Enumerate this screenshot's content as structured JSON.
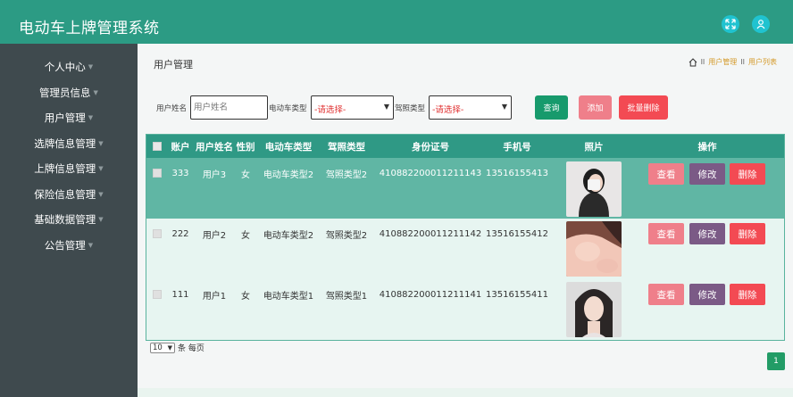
{
  "app": {
    "title": "电动车上牌管理系统"
  },
  "header_icons": [
    "fullscreen-icon",
    "user-icon"
  ],
  "sidebar": {
    "items": [
      {
        "label": "个人中心"
      },
      {
        "label": "管理员信息"
      },
      {
        "label": "用户管理"
      },
      {
        "label": "选牌信息管理"
      },
      {
        "label": "上牌信息管理"
      },
      {
        "label": "保险信息管理"
      },
      {
        "label": "基础数据管理"
      },
      {
        "label": "公告管理"
      }
    ]
  },
  "page": {
    "title": "用户管理",
    "breadcrumb": {
      "sep1": "II",
      "item1": "用户管理",
      "sep2": "II",
      "item2": "用户列表"
    }
  },
  "search": {
    "name_label": "用户姓名",
    "name_placeholder": "用户姓名",
    "ev_type_label": "电动车类型",
    "ev_type_value": "-请选择-",
    "license_label": "驾照类型",
    "license_value": "-请选择-",
    "query_btn": "查询",
    "add_btn": "添加",
    "batch_delete_btn": "批量删除"
  },
  "table": {
    "headers": [
      "账户",
      "用户姓名",
      "性别",
      "电动车类型",
      "驾照类型",
      "身份证号",
      "手机号",
      "照片",
      "操作"
    ],
    "rows": [
      {
        "account": "333",
        "name": "用户3",
        "gender": "女",
        "ev_type": "电动车类型2",
        "license": "驾照类型2",
        "id_no": "410882200011211143",
        "phone": "13516155413"
      },
      {
        "account": "222",
        "name": "用户2",
        "gender": "女",
        "ev_type": "电动车类型2",
        "license": "驾照类型2",
        "id_no": "410882200011211142",
        "phone": "13516155412"
      },
      {
        "account": "111",
        "name": "用户1",
        "gender": "女",
        "ev_type": "电动车类型1",
        "license": "驾照类型1",
        "id_no": "410882200011211141",
        "phone": "13516155411"
      }
    ],
    "actions": {
      "view": "查看",
      "edit": "修改",
      "delete": "删除"
    }
  },
  "pagination": {
    "page_size": "10",
    "per_page_label": "条 每页",
    "current_page": "1"
  },
  "colors": {
    "header": "#2c9b84",
    "sidebar": "#3f4a4e",
    "table_header": "#2f9985",
    "view_btn": "#ef7f8a",
    "edit_btn": "#7b5a86",
    "delete_btn": "#f34a53",
    "query_btn": "#179a6c"
  }
}
